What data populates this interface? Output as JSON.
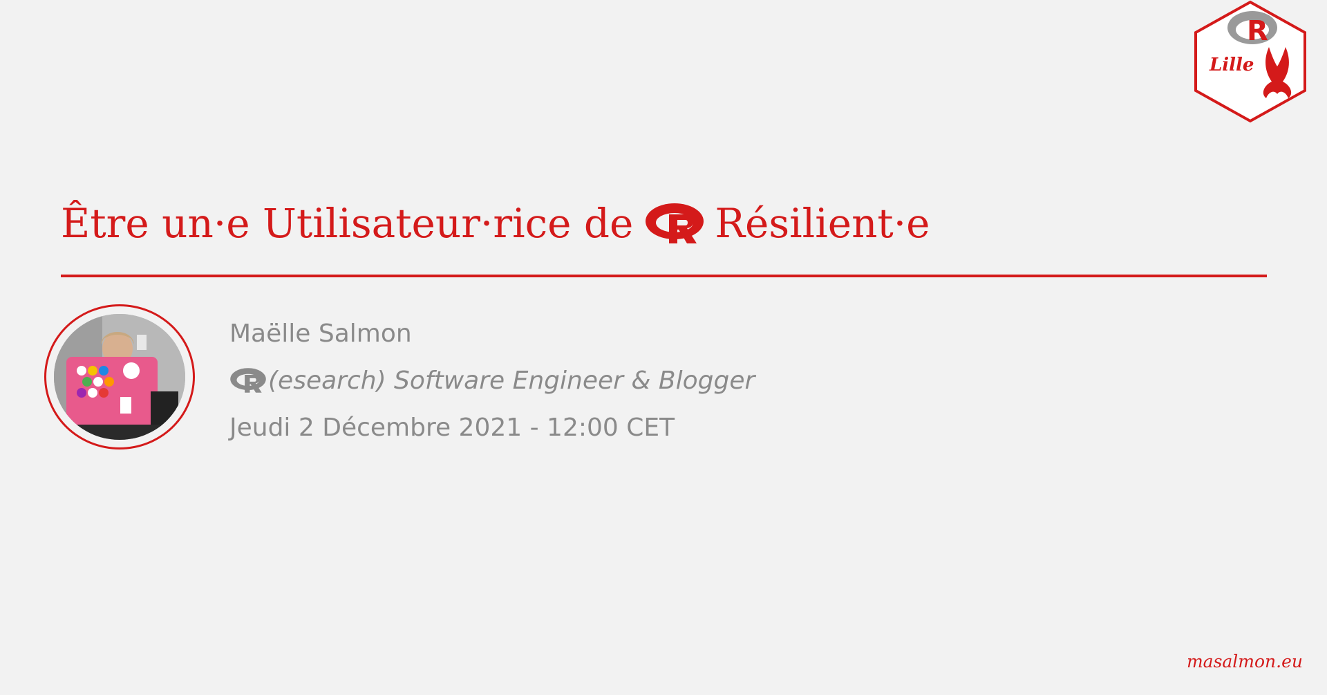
{
  "slide": {
    "title": {
      "before": "Être un·e Utilisateur·rice de",
      "after": "Résilient·e",
      "icon": "r-logo-icon"
    },
    "logo": {
      "icon": "r-lille-hex-logo",
      "text": "Lille",
      "letter": "R"
    },
    "speaker": {
      "name": "Maëlle Salmon",
      "role": "(esearch) Software Engineer & Blogger",
      "role_icon": "r-logo-icon",
      "date": "Jeudi 2 Décembre 2021 - 12:00 CET",
      "avatar": "speaker-photo"
    },
    "footer": "masalmon.eu"
  },
  "colors": {
    "accent": "#d41a1a",
    "background": "#f2f2f2",
    "muted_text": "#8a8a8a"
  }
}
